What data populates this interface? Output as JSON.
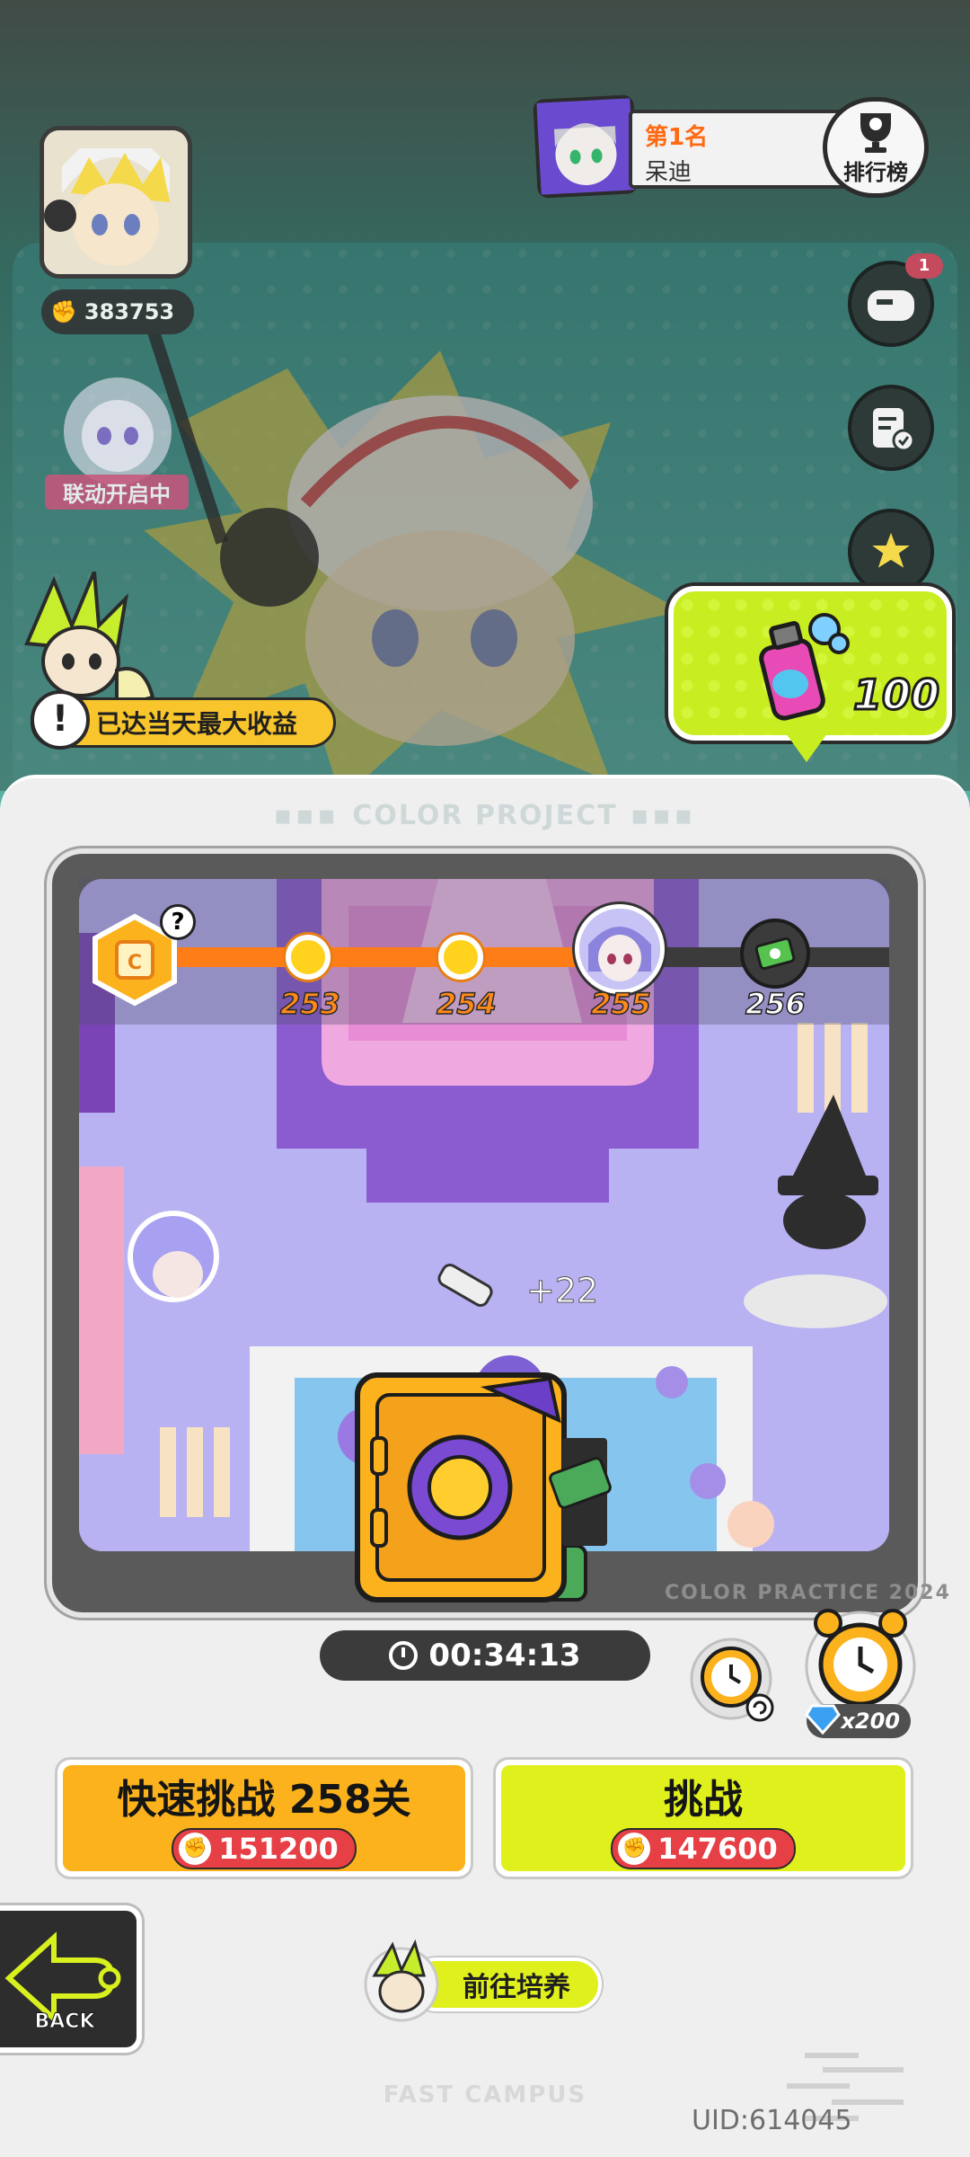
{
  "player": {
    "power": "383753",
    "collab_label": "联动开启中"
  },
  "ranking": {
    "position": "第1名",
    "name": "呆迪",
    "button_label": "排行榜"
  },
  "side_menu": {
    "badge_count": "1"
  },
  "notice": {
    "max_income": "已达当天最大收益",
    "icon": "!"
  },
  "paint_reward": {
    "amount": "100"
  },
  "sheet": {
    "title": "COLOR PROJECT",
    "watermark": "COLOR PRACTICE 2024",
    "footer": "FAST CAMPUS",
    "uid": "UID:614045"
  },
  "progress": {
    "help": "?",
    "stages": [
      "253",
      "254",
      "255",
      "256"
    ]
  },
  "map": {
    "gain": "+22"
  },
  "timer": {
    "value": "00:34:13"
  },
  "speedup": {
    "diamond_cost": "x200"
  },
  "buttons": {
    "quick_challenge": "快速挑战 258关",
    "quick_cost": "151200",
    "challenge": "挑战",
    "challenge_cost": "147600",
    "back": "BACK",
    "cultivate": "前往培养"
  },
  "colors": {
    "accent_orange": "#fbb21c",
    "accent_lime": "#dff01d",
    "cost_red": "#e63f45",
    "progress_orange": "#ff7d16"
  }
}
